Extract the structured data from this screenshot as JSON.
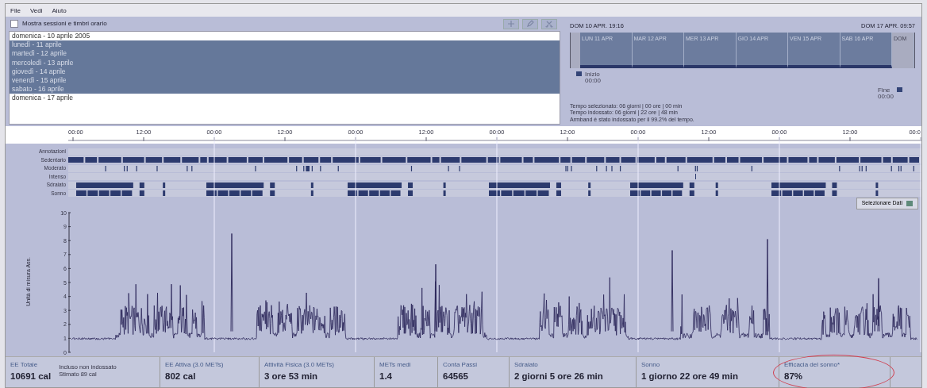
{
  "menu": [
    {
      "label": "File"
    },
    {
      "label": "Vedi"
    },
    {
      "label": "Aiuto"
    }
  ],
  "sessions_checkbox": {
    "label": "Mostra sessioni e timbri orario",
    "checked": false
  },
  "toolbar": [
    {
      "kind": "add"
    },
    {
      "kind": "edit"
    },
    {
      "kind": "cut"
    }
  ],
  "days": [
    {
      "label": "domenica - 10 aprile 2005",
      "selected": false
    },
    {
      "label": "lunedì - 11 aprile",
      "selected": true
    },
    {
      "label": "martedì - 12 aprile",
      "selected": true
    },
    {
      "label": "mercoledì - 13 aprile",
      "selected": true
    },
    {
      "label": "giovedì - 14 aprile",
      "selected": true
    },
    {
      "label": "venerdì - 15 aprile",
      "selected": true
    },
    {
      "label": "sabato - 16 aprile",
      "selected": true
    },
    {
      "label": "domenica - 17 aprile",
      "selected": false
    }
  ],
  "timeline": {
    "start": "DOM 10 APR. 19:16",
    "end": "DOM 17 APR. 09:57",
    "days": [
      {
        "label": "LUN 11 APR",
        "selected": true
      },
      {
        "label": "MAR 12 APR",
        "selected": true
      },
      {
        "label": "MER 13 APR",
        "selected": true
      },
      {
        "label": "GIO 14 APR",
        "selected": true
      },
      {
        "label": "VEN 15 APR",
        "selected": true
      },
      {
        "label": "SAB 16 APR",
        "selected": true
      },
      {
        "label": "DOM",
        "selected": false
      }
    ],
    "start_handle": {
      "label": "Inizio",
      "time": "00:00"
    },
    "end_handle": {
      "label": "Fine",
      "time": "00:00"
    },
    "info": [
      "Tempo selezionato:  06 giorni | 00 ore | 00 min",
      "Tempo indossato:  06 giorni | 22 ore | 48 min",
      "Armband è stato indossato per il 99.2% del tempo."
    ]
  },
  "ruler": [
    "00:00",
    "12:00",
    "00:00",
    "12:00",
    "00:00",
    "12:00",
    "00:00",
    "12:00",
    "00:00",
    "12:00",
    "00:00",
    "12:00",
    "00:0"
  ],
  "activity_rows": [
    {
      "label": "Annotazioni",
      "kind": "annotations"
    },
    {
      "label": "Sedentario",
      "kind": "sedentary"
    },
    {
      "label": "Moderato",
      "kind": "moderate"
    },
    {
      "label": "Intenso",
      "kind": "vigorous"
    },
    {
      "label": "Sdraiato",
      "kind": "lying"
    },
    {
      "label": "Sonno",
      "kind": "sleep"
    }
  ],
  "select_data_button": "Selezionare Dati",
  "chart": {
    "ylabel": "Unità di misura Ass.",
    "yticks": [
      "10",
      "9",
      "8",
      "7",
      "6",
      "5",
      "4",
      "3",
      "2",
      "1",
      "0"
    ]
  },
  "stats": [
    {
      "label": "EE Totale",
      "value": "10691 cal",
      "notes": [
        "Incluso non indossato",
        "Stimato 89 cal"
      ],
      "highlighted": false
    },
    {
      "label": "EE Attiva (3.0 METs)",
      "value": "802 cal",
      "highlighted": false
    },
    {
      "label": "Attività Fisica (3.0 METs)",
      "value": "3 ore 53 min",
      "highlighted": false
    },
    {
      "label": "METs medi",
      "value": "1.4",
      "highlighted": false
    },
    {
      "label": "Conta Passi",
      "value": "64565",
      "highlighted": false
    },
    {
      "label": "Sdraiato",
      "value": "2 giorni 5 ore 26 min",
      "highlighted": false
    },
    {
      "label": "Sonno",
      "value": "1 giorno 22 ore 49 min",
      "highlighted": false
    },
    {
      "label": "Efficacia del sonno*",
      "value": "87%",
      "highlighted": true
    }
  ]
}
